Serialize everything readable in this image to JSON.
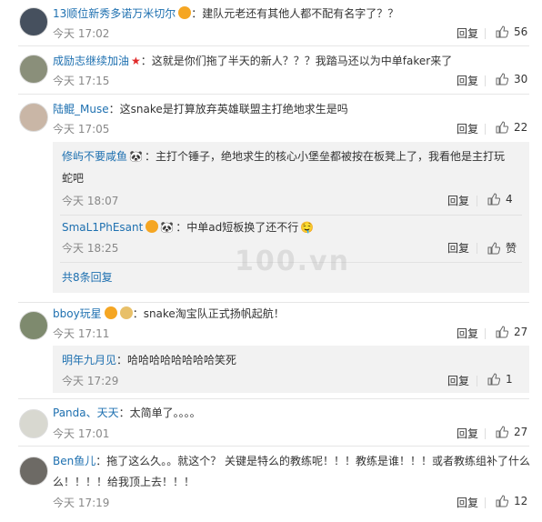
{
  "watermark": "100.vn",
  "comments": [
    {
      "user": "13顺位新秀多诺万米切尔",
      "text": "：建队元老还有其他人都不配有名字了？？",
      "time": "今天 17:02",
      "reply": "回复",
      "likes": "56"
    },
    {
      "user": "成励志继续加油",
      "text": "：这就是你们拖了半天的新人？？？我踏马还以为中单faker来了",
      "time": "今天 17:15",
      "reply": "回复",
      "likes": "30"
    },
    {
      "user": "陆鲲_Muse",
      "text": "：这snake是打算放弃英雄联盟主打绝地求生是吗",
      "time": "今天 17:05",
      "reply": "回复",
      "likes": "22",
      "replies": [
        {
          "user": "修屿不要咸鱼",
          "text_line1": "：主打个锤子，绝地求生的核心小堡垒都被按在板凳上了，我看他是主打玩",
          "text_line2": "蛇吧",
          "time": "今天 18:07",
          "reply": "回复",
          "likes": "4"
        },
        {
          "user": "SmaL1PhEsant",
          "text": "：中单ad短板换了还不行",
          "time": "今天 18:25",
          "reply": "回复",
          "likes": "赞"
        }
      ],
      "more": "共8条回复"
    },
    {
      "user": "bboy玩星",
      "text": "：snake淘宝队正式扬帆起航！",
      "time": "今天 17:11",
      "reply": "回复",
      "likes": "27",
      "replies": [
        {
          "user": "明年九月见",
          "text": "：哈哈哈哈哈哈哈哈笑死",
          "time": "今天 17:29",
          "reply": "回复",
          "likes": "1"
        }
      ]
    },
    {
      "user": "Panda、天天",
      "text": "：太简单了。。。。",
      "time": "今天 17:01",
      "reply": "回复",
      "likes": "27"
    },
    {
      "user": "Ben鱼儿",
      "text_line1": "：拖了这么久。。就这个？ 关键是特么的教练呢！！！教练是谁！！！或者教练组补了什么",
      "text_line2": "么！！！！给我顶上去！！！",
      "time": "今天 17:19",
      "reply": "回复",
      "likes": "12"
    }
  ],
  "colors": {
    "link": "#1e70b0",
    "meta": "#888888",
    "subbg": "#f2f2f2"
  }
}
